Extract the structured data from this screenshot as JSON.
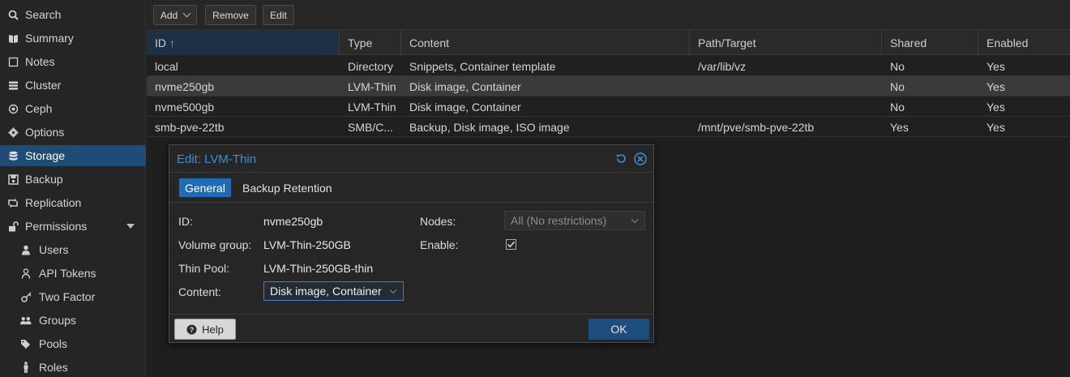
{
  "sidebar": {
    "items": [
      {
        "label": "Search",
        "icon": "search-icon"
      },
      {
        "label": "Summary",
        "icon": "book-icon"
      },
      {
        "label": "Notes",
        "icon": "note-icon"
      },
      {
        "label": "Cluster",
        "icon": "server-icon"
      },
      {
        "label": "Ceph",
        "icon": "ceph-icon"
      },
      {
        "label": "Options",
        "icon": "gear-icon"
      },
      {
        "label": "Storage",
        "icon": "database-icon"
      },
      {
        "label": "Backup",
        "icon": "floppy-icon"
      },
      {
        "label": "Replication",
        "icon": "retweet-icon"
      },
      {
        "label": "Permissions",
        "icon": "unlock-icon"
      },
      {
        "label": "Users",
        "icon": "user-icon"
      },
      {
        "label": "API Tokens",
        "icon": "person-icon"
      },
      {
        "label": "Two Factor",
        "icon": "key-icon"
      },
      {
        "label": "Groups",
        "icon": "users-icon"
      },
      {
        "label": "Pools",
        "icon": "tags-icon"
      },
      {
        "label": "Roles",
        "icon": "male-icon"
      }
    ],
    "active_label": "Storage"
  },
  "toolbar": {
    "add_label": "Add",
    "remove_label": "Remove",
    "edit_label": "Edit"
  },
  "grid": {
    "columns": [
      "ID",
      "Type",
      "Content",
      "Path/Target",
      "Shared",
      "Enabled"
    ],
    "sort_indicator": "↑",
    "rows": [
      [
        "local",
        "Directory",
        "Snippets, Container template",
        "/var/lib/vz",
        "No",
        "Yes"
      ],
      [
        "nvme250gb",
        "LVM-Thin",
        "Disk image, Container",
        "",
        "No",
        "Yes"
      ],
      [
        "nvme500gb",
        "LVM-Thin",
        "Disk image, Container",
        "",
        "No",
        "Yes"
      ],
      [
        "smb-pve-22tb",
        "SMB/C...",
        "Backup, Disk image, ISO image",
        "/mnt/pve/smb-pve-22tb",
        "Yes",
        "Yes"
      ]
    ]
  },
  "dialog": {
    "title": "Edit: LVM-Thin",
    "tabs": [
      "General",
      "Backup Retention"
    ],
    "fields": {
      "id_label": "ID:",
      "id_value": "nvme250gb",
      "vg_label": "Volume group:",
      "vg_value": "LVM-Thin-250GB",
      "pool_label": "Thin Pool:",
      "pool_value": "LVM-Thin-250GB-thin",
      "content_label": "Content:",
      "content_value": "Disk image, Container",
      "nodes_label": "Nodes:",
      "nodes_value": "All (No restrictions)",
      "enable_label": "Enable:"
    },
    "help_label": "Help",
    "ok_label": "OK"
  },
  "colors": {
    "accent": "#1f6bb5",
    "title": "#3d8fd1",
    "active_nav": "#1e4c74"
  }
}
